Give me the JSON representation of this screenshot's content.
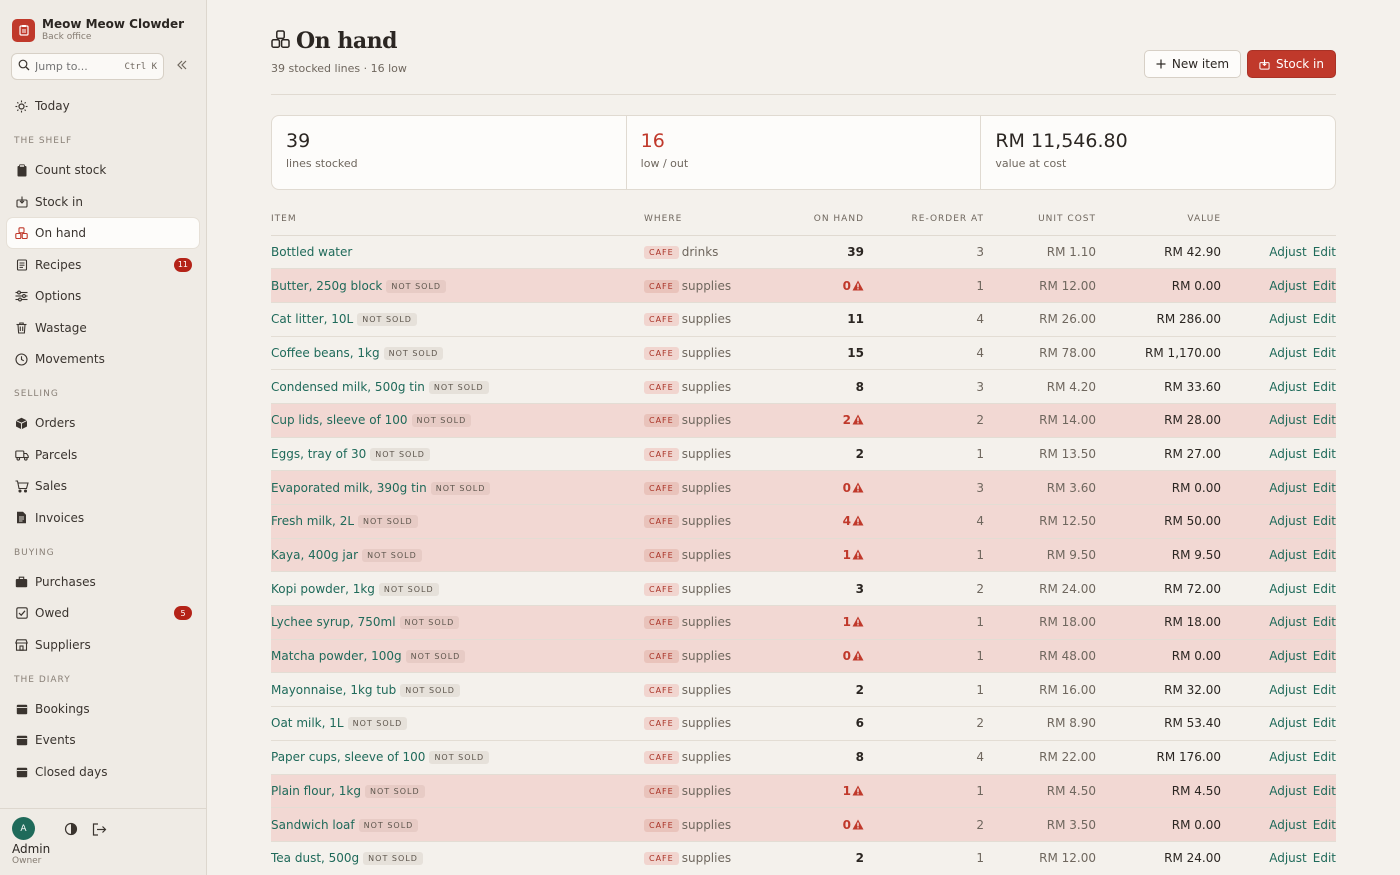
{
  "brand": {
    "name": "Meow Meow Clowder",
    "sub": "Back office"
  },
  "search": {
    "placeholder": "Jump to...",
    "shortcut": "Ctrl K"
  },
  "nav": {
    "today": "Today",
    "section_shelf": "THE SHELF",
    "count_stock": "Count stock",
    "stock_in": "Stock in",
    "on_hand": "On hand",
    "recipes": "Recipes",
    "recipes_badge": "11",
    "options": "Options",
    "wastage": "Wastage",
    "movements": "Movements",
    "section_selling": "SELLING",
    "orders": "Orders",
    "parcels": "Parcels",
    "sales": "Sales",
    "invoices": "Invoices",
    "section_buying": "BUYING",
    "purchases": "Purchases",
    "owed": "Owed",
    "owed_badge": "5",
    "suppliers": "Suppliers",
    "section_diary": "THE DIARY",
    "bookings": "Bookings",
    "events": "Events",
    "closed_days": "Closed days"
  },
  "user": {
    "initial": "A",
    "name": "Admin",
    "role": "Owner"
  },
  "page": {
    "title": "On hand",
    "subtitle": "39 stocked lines · 16 low",
    "new_item": "New item",
    "stock_in": "Stock in"
  },
  "stats": [
    {
      "value": "39",
      "label": "lines stocked"
    },
    {
      "value": "16",
      "label": "low / out"
    },
    {
      "value": "RM 11,546.80",
      "label": "value at cost"
    }
  ],
  "table": {
    "headers": {
      "item": "ITEM",
      "where": "WHERE",
      "on_hand": "ON HAND",
      "reorder": "RE-ORDER AT",
      "unit_cost": "UNIT COST",
      "value": "VALUE"
    },
    "adjust": "Adjust",
    "edit": "Edit",
    "rows": [
      {
        "name": "Bottled water",
        "tag": "",
        "loc": "CAFE",
        "cat": "drinks",
        "qty": "39",
        "low": false,
        "reorder": "3",
        "cost": "RM 1.10",
        "value": "RM 42.90"
      },
      {
        "name": "Butter, 250g block",
        "tag": "NOT SOLD",
        "loc": "CAFE",
        "cat": "supplies",
        "qty": "0",
        "low": true,
        "reorder": "1",
        "cost": "RM 12.00",
        "value": "RM 0.00"
      },
      {
        "name": "Cat litter, 10L",
        "tag": "NOT SOLD",
        "loc": "CAFE",
        "cat": "supplies",
        "qty": "11",
        "low": false,
        "reorder": "4",
        "cost": "RM 26.00",
        "value": "RM 286.00"
      },
      {
        "name": "Coffee beans, 1kg",
        "tag": "NOT SOLD",
        "loc": "CAFE",
        "cat": "supplies",
        "qty": "15",
        "low": false,
        "reorder": "4",
        "cost": "RM 78.00",
        "value": "RM 1,170.00"
      },
      {
        "name": "Condensed milk, 500g tin",
        "tag": "NOT SOLD",
        "loc": "CAFE",
        "cat": "supplies",
        "qty": "8",
        "low": false,
        "reorder": "3",
        "cost": "RM 4.20",
        "value": "RM 33.60"
      },
      {
        "name": "Cup lids, sleeve of 100",
        "tag": "NOT SOLD",
        "loc": "CAFE",
        "cat": "supplies",
        "qty": "2",
        "low": true,
        "reorder": "2",
        "cost": "RM 14.00",
        "value": "RM 28.00"
      },
      {
        "name": "Eggs, tray of 30",
        "tag": "NOT SOLD",
        "loc": "CAFE",
        "cat": "supplies",
        "qty": "2",
        "low": false,
        "reorder": "1",
        "cost": "RM 13.50",
        "value": "RM 27.00"
      },
      {
        "name": "Evaporated milk, 390g tin",
        "tag": "NOT SOLD",
        "loc": "CAFE",
        "cat": "supplies",
        "qty": "0",
        "low": true,
        "reorder": "3",
        "cost": "RM 3.60",
        "value": "RM 0.00"
      },
      {
        "name": "Fresh milk, 2L",
        "tag": "NOT SOLD",
        "loc": "CAFE",
        "cat": "supplies",
        "qty": "4",
        "low": true,
        "reorder": "4",
        "cost": "RM 12.50",
        "value": "RM 50.00"
      },
      {
        "name": "Kaya, 400g jar",
        "tag": "NOT SOLD",
        "loc": "CAFE",
        "cat": "supplies",
        "qty": "1",
        "low": true,
        "reorder": "1",
        "cost": "RM 9.50",
        "value": "RM 9.50"
      },
      {
        "name": "Kopi powder, 1kg",
        "tag": "NOT SOLD",
        "loc": "CAFE",
        "cat": "supplies",
        "qty": "3",
        "low": false,
        "reorder": "2",
        "cost": "RM 24.00",
        "value": "RM 72.00"
      },
      {
        "name": "Lychee syrup, 750ml",
        "tag": "NOT SOLD",
        "loc": "CAFE",
        "cat": "supplies",
        "qty": "1",
        "low": true,
        "reorder": "1",
        "cost": "RM 18.00",
        "value": "RM 18.00"
      },
      {
        "name": "Matcha powder, 100g",
        "tag": "NOT SOLD",
        "loc": "CAFE",
        "cat": "supplies",
        "qty": "0",
        "low": true,
        "reorder": "1",
        "cost": "RM 48.00",
        "value": "RM 0.00"
      },
      {
        "name": "Mayonnaise, 1kg tub",
        "tag": "NOT SOLD",
        "loc": "CAFE",
        "cat": "supplies",
        "qty": "2",
        "low": false,
        "reorder": "1",
        "cost": "RM 16.00",
        "value": "RM 32.00"
      },
      {
        "name": "Oat milk, 1L",
        "tag": "NOT SOLD",
        "loc": "CAFE",
        "cat": "supplies",
        "qty": "6",
        "low": false,
        "reorder": "2",
        "cost": "RM 8.90",
        "value": "RM 53.40"
      },
      {
        "name": "Paper cups, sleeve of 100",
        "tag": "NOT SOLD",
        "loc": "CAFE",
        "cat": "supplies",
        "qty": "8",
        "low": false,
        "reorder": "4",
        "cost": "RM 22.00",
        "value": "RM 176.00"
      },
      {
        "name": "Plain flour, 1kg",
        "tag": "NOT SOLD",
        "loc": "CAFE",
        "cat": "supplies",
        "qty": "1",
        "low": true,
        "reorder": "1",
        "cost": "RM 4.50",
        "value": "RM 4.50"
      },
      {
        "name": "Sandwich loaf",
        "tag": "NOT SOLD",
        "loc": "CAFE",
        "cat": "supplies",
        "qty": "0",
        "low": true,
        "reorder": "2",
        "cost": "RM 3.50",
        "value": "RM 0.00"
      },
      {
        "name": "Tea dust, 500g",
        "tag": "NOT SOLD",
        "loc": "CAFE",
        "cat": "supplies",
        "qty": "2",
        "low": false,
        "reorder": "1",
        "cost": "RM 12.00",
        "value": "RM 24.00"
      }
    ]
  },
  "colors": {
    "accent": "#c0392b",
    "link": "#1f6a5a",
    "low_row": "#f2d8d3",
    "background": "#f4f1ec"
  }
}
